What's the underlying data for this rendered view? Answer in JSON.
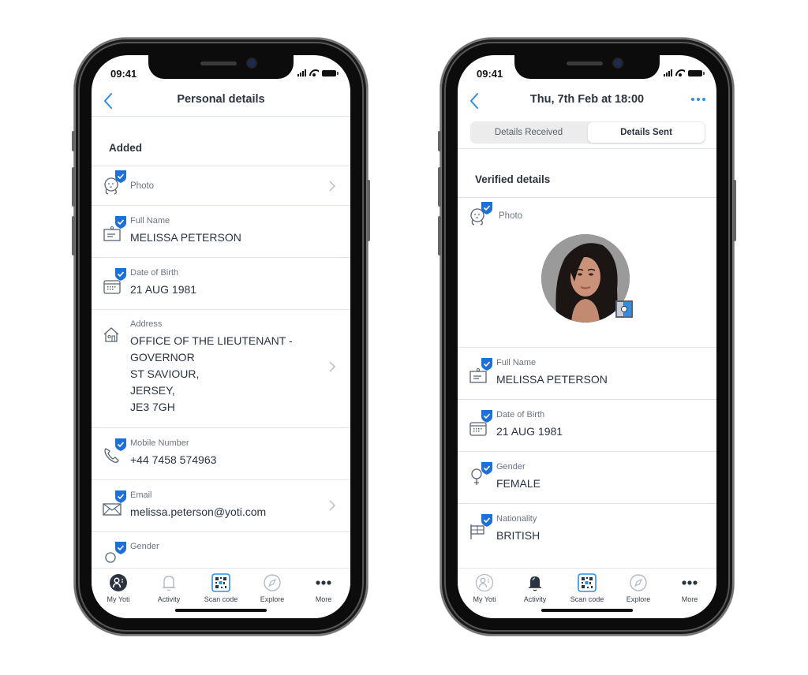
{
  "colors": {
    "accent": "#2d8ee6",
    "verified_badge": "#1f6fd8",
    "text_primary": "#2b3340",
    "text_secondary": "#6c7480",
    "divider": "#e1e5eb"
  },
  "left_phone": {
    "status": {
      "time": "09:41"
    },
    "header": {
      "back_icon": "chevron-left-icon",
      "title": "Personal details"
    },
    "section_title": "Added",
    "rows": [
      {
        "icon": "face-icon",
        "verified": true,
        "label": "Photo",
        "value": "",
        "chevron": true
      },
      {
        "icon": "id-card-icon",
        "verified": true,
        "label": "Full Name",
        "value": "MELISSA PETERSON",
        "chevron": false
      },
      {
        "icon": "calendar-icon",
        "verified": true,
        "label": "Date of Birth",
        "value": "21 AUG 1981",
        "chevron": false
      },
      {
        "icon": "house-icon",
        "verified": false,
        "label": "Address",
        "value": "OFFICE OF THE LIEUTENANT -\nGOVERNOR\nST SAVIOUR,\nJERSEY,\nJE3 7GH",
        "chevron": true
      },
      {
        "icon": "phone-icon",
        "verified": true,
        "label": "Mobile Number",
        "value": "+44 7458 574963",
        "chevron": false
      },
      {
        "icon": "envelope-icon",
        "verified": true,
        "label": "Email",
        "value": "melissa.peterson@yoti.com",
        "chevron": true
      },
      {
        "icon": "gender-icon",
        "verified": true,
        "label": "Gender",
        "value": "",
        "chevron": false
      }
    ],
    "tabbar": [
      {
        "label": "My Yoti",
        "icon": "my-yoti-icon",
        "active": true
      },
      {
        "label": "Activity",
        "icon": "bell-icon",
        "active": false
      },
      {
        "label": "Scan code",
        "icon": "qr-code-icon",
        "active": false
      },
      {
        "label": "Explore",
        "icon": "compass-icon",
        "active": false
      },
      {
        "label": "More",
        "icon": "more-dots-icon",
        "active": false
      }
    ]
  },
  "right_phone": {
    "status": {
      "time": "09:41"
    },
    "header": {
      "back_icon": "chevron-left-icon",
      "title": "Thu, 7th Feb at 18:00",
      "more_icon": "more-horizontal-icon"
    },
    "segments": [
      {
        "label": "Details Received",
        "active": false
      },
      {
        "label": "Details Sent",
        "active": true
      }
    ],
    "section_title": "Verified details",
    "photo_row": {
      "icon": "face-icon",
      "verified": true,
      "label": "Photo",
      "image": "profile-photo"
    },
    "rows": [
      {
        "icon": "id-card-icon",
        "verified": true,
        "label": "Full Name",
        "value": "MELISSA PETERSON"
      },
      {
        "icon": "calendar-icon",
        "verified": true,
        "label": "Date of Birth",
        "value": "21 AUG 1981"
      },
      {
        "icon": "female-icon",
        "verified": true,
        "label": "Gender",
        "value": "FEMALE"
      },
      {
        "icon": "flag-icon",
        "verified": true,
        "label": "Nationality",
        "value": "BRITISH"
      }
    ],
    "tabbar": [
      {
        "label": "My Yoti",
        "icon": "my-yoti-icon",
        "active": false
      },
      {
        "label": "Activity",
        "icon": "bell-icon",
        "active": true
      },
      {
        "label": "Scan code",
        "icon": "qr-code-icon",
        "active": false
      },
      {
        "label": "Explore",
        "icon": "compass-icon",
        "active": false
      },
      {
        "label": "More",
        "icon": "more-dots-icon",
        "active": false
      }
    ]
  }
}
